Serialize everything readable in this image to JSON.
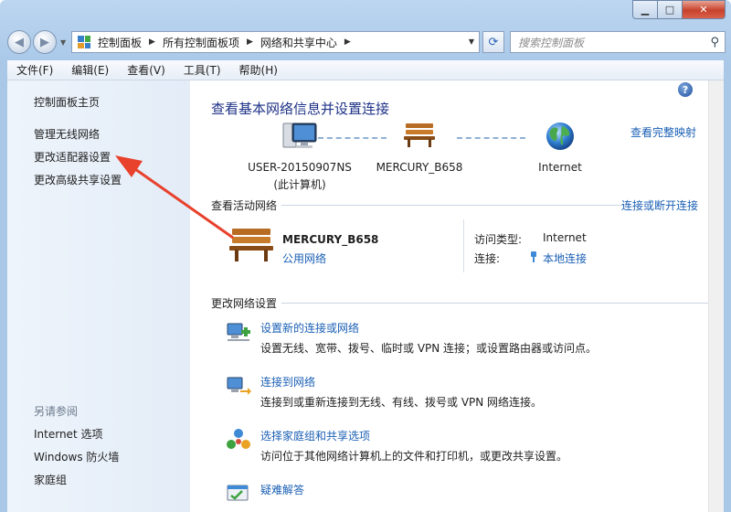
{
  "window": {
    "caption": {
      "min_glyph": "▁",
      "max_glyph": "□",
      "close_glyph": "✕"
    }
  },
  "nav": {
    "back_glyph": "◀",
    "forward_glyph": "▶",
    "history_glyph": "▼",
    "breadcrumbs": [
      "控制面板",
      "所有控制面板项",
      "网络和共享中心"
    ],
    "crumb_sep": "▶",
    "dropdown_glyph": "▼",
    "refresh_glyph": "⟳",
    "search_placeholder": "搜索控制面板",
    "search_glyph": "⚲"
  },
  "menu": [
    "文件(F)",
    "编辑(E)",
    "查看(V)",
    "工具(T)",
    "帮助(H)"
  ],
  "sidebar": {
    "home": "控制面板主页",
    "items": [
      "管理无线网络",
      "更改适配器设置",
      "更改高级共享设置"
    ],
    "see_also_label": "另请参阅",
    "see_also": [
      "Internet 选项",
      "Windows 防火墙",
      "家庭组"
    ]
  },
  "main": {
    "help_glyph": "?",
    "title": "查看基本网络信息并设置连接",
    "full_map_link": "查看完整映射",
    "map": {
      "computer_name": "USER-20150907NS",
      "computer_sub": "(此计算机)",
      "network_name": "MERCURY_B658",
      "internet_label": "Internet"
    },
    "active": {
      "header": "查看活动网络",
      "connect_link": "连接或断开连接",
      "network_name": "MERCURY_B658",
      "network_type": "公用网络",
      "access_type_label": "访问类型:",
      "access_type_value": "Internet",
      "connection_label": "连接:",
      "connection_value": "本地连接"
    },
    "change": {
      "header": "更改网络设置",
      "tasks": [
        {
          "link": "设置新的连接或网络",
          "desc": "设置无线、宽带、拨号、临时或 VPN 连接；或设置路由器或访问点。"
        },
        {
          "link": "连接到网络",
          "desc": "连接到或重新连接到无线、有线、拨号或 VPN 网络连接。"
        },
        {
          "link": "选择家庭组和共享选项",
          "desc": "访问位于其他网络计算机上的文件和打印机，或更改共享设置。"
        },
        {
          "link": "疑难解答",
          "desc": ""
        }
      ]
    }
  },
  "colors": {
    "link": "#1a5fb4",
    "title": "#1e3287",
    "annotation_arrow": "#e8412c"
  }
}
